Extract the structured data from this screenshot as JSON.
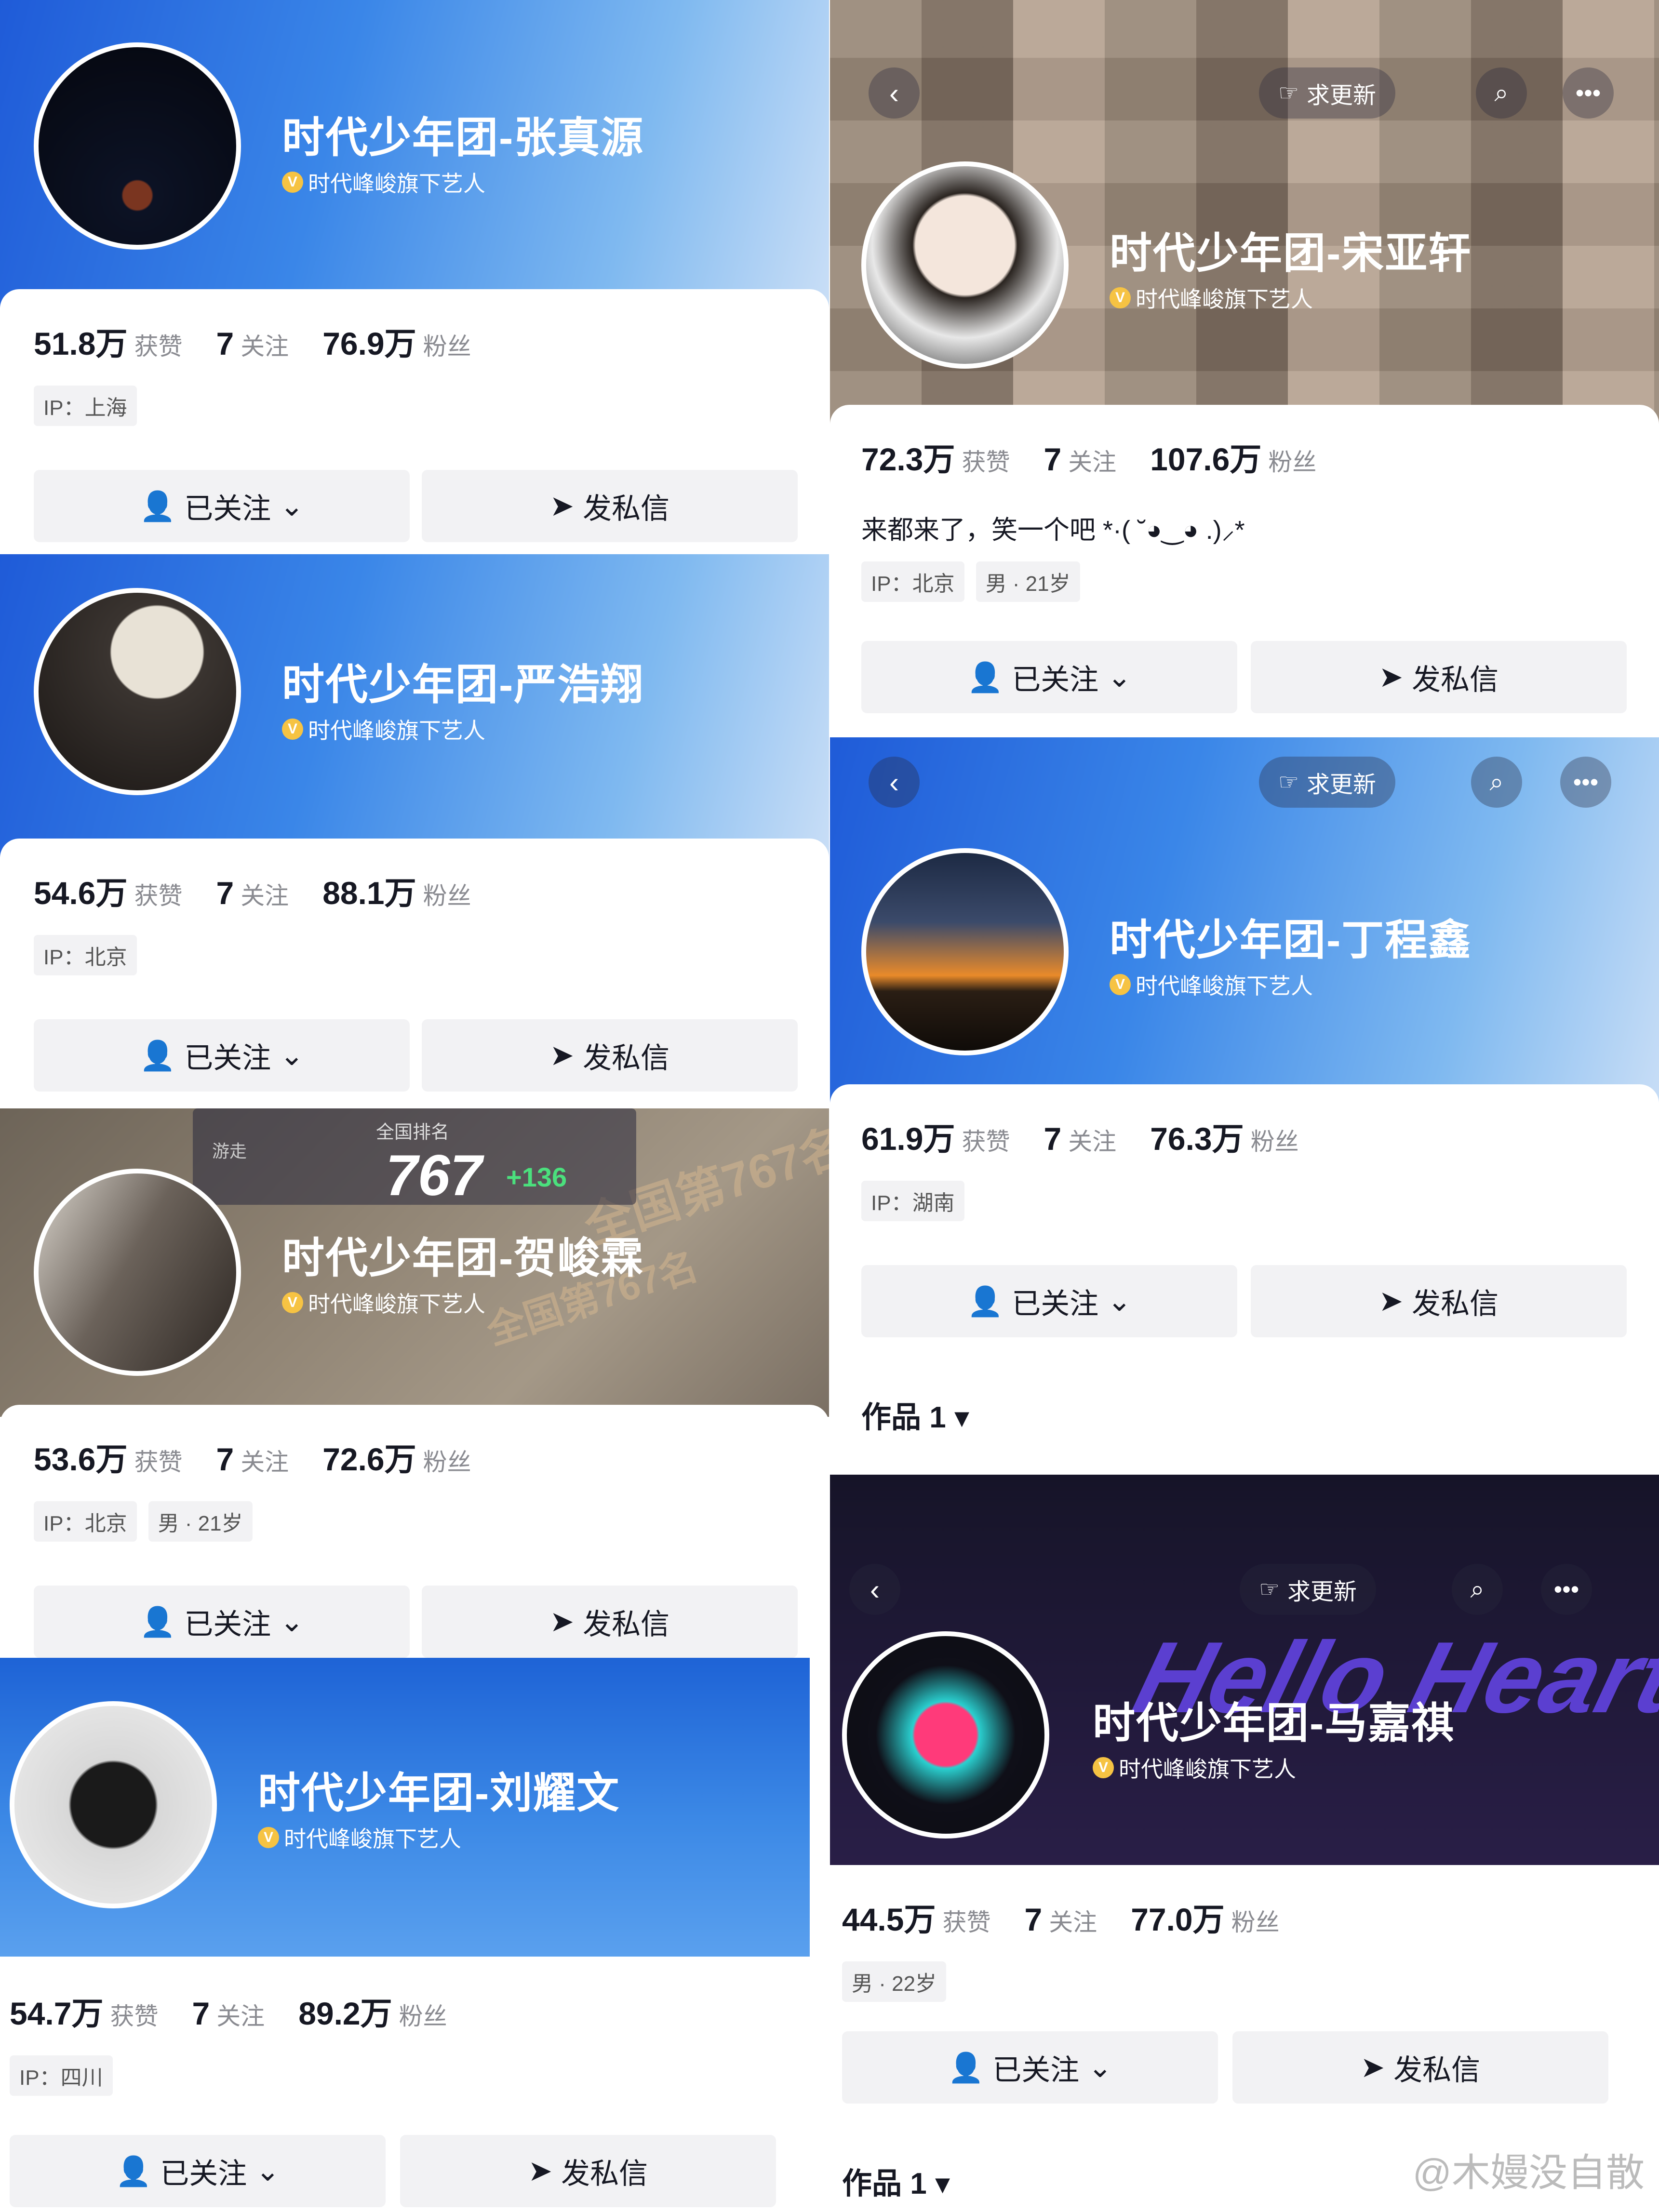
{
  "common": {
    "likes_label": "获赞",
    "following_label": "关注",
    "fans_label": "粉丝",
    "verified_text": "时代峰峻旗下艺人",
    "verified_badge": "V",
    "follow_btn": "已关注",
    "message_btn": "发私信",
    "update_btn": "求更新",
    "works_label": "作品 1"
  },
  "profiles": {
    "zhang": {
      "name": "时代少年团-张真源",
      "likes": "51.8万",
      "following": "7",
      "fans": "76.9万",
      "ip": "IP：上海"
    },
    "song": {
      "name": "时代少年团-宋亚轩",
      "likes": "72.3万",
      "following": "7",
      "fans": "107.6万",
      "bio": "来都来了，笑一个吧 *·( ˘◕‿◕ .)⸝*",
      "ip": "IP：北京",
      "gender_age": "男 · 21岁"
    },
    "yan": {
      "name": "时代少年团-严浩翔",
      "likes": "54.6万",
      "following": "7",
      "fans": "88.1万",
      "ip": "IP：北京"
    },
    "ding": {
      "name": "时代少年团-丁程鑫",
      "likes": "61.9万",
      "following": "7",
      "fans": "76.3万",
      "ip": "IP：湖南"
    },
    "he": {
      "name": "时代少年团-贺峻霖",
      "likes": "53.6万",
      "following": "7",
      "fans": "72.6万",
      "ip": "IP：北京",
      "gender_age": "男 · 21岁",
      "rank_label": "全国排名",
      "rank_num": "767",
      "rank_delta": "+136",
      "rank_small": "游走",
      "ghost_text": "全国第767名"
    },
    "ma": {
      "name": "时代少年团-马嘉祺",
      "likes": "44.5万",
      "following": "7",
      "fans": "77.0万",
      "gender_age": "男 · 22岁",
      "banner_text": "Hello Heart"
    },
    "liu": {
      "name": "时代少年团-刘耀文",
      "likes": "54.7万",
      "following": "7",
      "fans": "89.2万",
      "ip": "IP：四川"
    }
  },
  "watermark": "@木嫚没自散",
  "colors": {
    "banner_blue": "#2f78e0",
    "verified_gold": "#f6c343",
    "muted_text": "#8a8b91"
  }
}
